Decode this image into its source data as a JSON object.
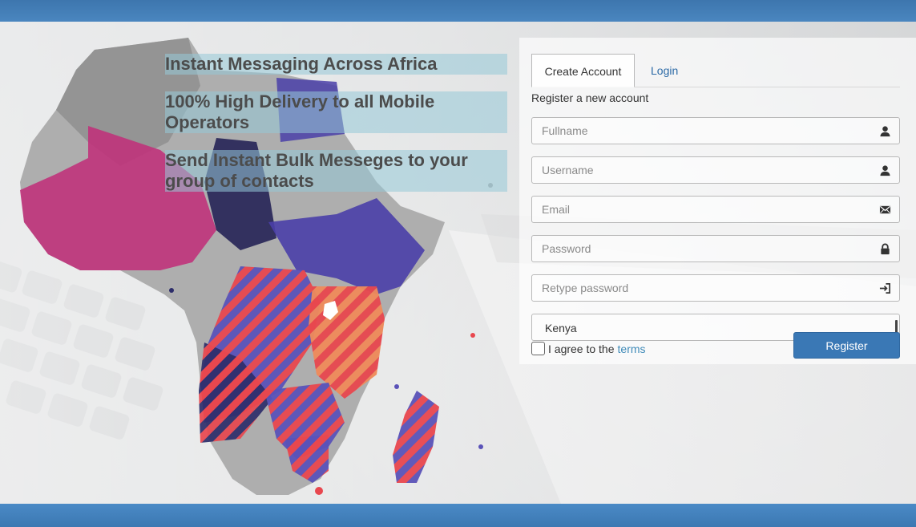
{
  "headlines": {
    "line1": "Instant Messaging Across Africa",
    "line2": "100% High Delivery to all Mobile Operators",
    "line3": "Send Instant Bulk Messeges to your group of contacts"
  },
  "tabs": {
    "create_account": "Create Account",
    "login": "Login"
  },
  "form": {
    "subtitle": "Register a new account",
    "fullname_placeholder": "Fullname",
    "username_placeholder": "Username",
    "email_placeholder": "Email",
    "password_placeholder": "Password",
    "retype_placeholder": "Retype password",
    "country_selected": "Kenya",
    "agree_text": "I agree to the",
    "terms_link": "terms",
    "register_label": "Register"
  },
  "icons": {
    "fullname": "user-icon",
    "username": "user-icon",
    "email": "envelope-icon",
    "password": "lock-icon",
    "retype": "login-arrow-icon"
  },
  "colors": {
    "header_blue": "#3d76ae",
    "primary_button": "#3a78b5",
    "link_blue": "#2c6aa6",
    "map_magenta": "#c0307a",
    "map_indigo": "#4a3fa8",
    "map_stripe_red": "#e8474e",
    "map_stripe_orange": "#ef8a5a",
    "map_gray": "#9a9a9a"
  }
}
